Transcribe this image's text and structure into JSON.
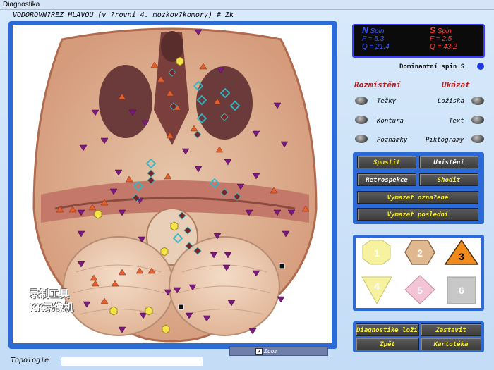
{
  "window": {
    "title": "Diagnostika"
  },
  "heading": "VODOROVN?ŘEZ HLAVOU (v ?rovni 4. mozkov?komory) # Zk",
  "scan": {
    "watermark_line1": "录制工具",
    "watermark_line2": "KK录像机"
  },
  "spin": {
    "left_title_letter": "N",
    "left_title_word": "Spin",
    "left_f": "F = 5.3",
    "left_q": "Q = 21.4",
    "right_title_letter": "S",
    "right_title_word": "Spin",
    "right_f": "F = 2.5",
    "right_q": "Q = 43.2",
    "left_color": "#3b57ff",
    "right_color": "#ff3b3b"
  },
  "dominant": {
    "label": "Dominantní spin S",
    "color": "#1c3ce0"
  },
  "rozmisteni": {
    "title": "Rozmístění",
    "options": [
      "Težky",
      "Kontura",
      "Poznámky"
    ]
  },
  "ukazat": {
    "title": "Ukázat",
    "options": [
      "Ložiska",
      "Text",
      "Piktogramy"
    ]
  },
  "controls": {
    "spustit": "Spustit",
    "umisteni": "Umístění",
    "retrospekce": "Retrospekce",
    "shodit": "Shodit",
    "vymazat_oznacene": "Vymazat ozna?ené",
    "vymazat_posledni": "Vymazat poslední"
  },
  "shapes": {
    "labels": [
      "1",
      "2",
      "3",
      "4",
      "5",
      "6"
    ],
    "colors": [
      "#f6f2a0",
      "#e0b890",
      "#f08a1a",
      "#f6f2a0",
      "#f3c3d6",
      "#c8c8c8"
    ]
  },
  "bottom": {
    "diagnostika": "Diagnostike ložisk",
    "zastavit": "Zastavit",
    "zpet": "Zpět",
    "kartoteka": "Kartotéka"
  },
  "topologie": {
    "label": "Topologie"
  },
  "zoom": {
    "label": "Zoom",
    "checked_glyph": "✔"
  }
}
